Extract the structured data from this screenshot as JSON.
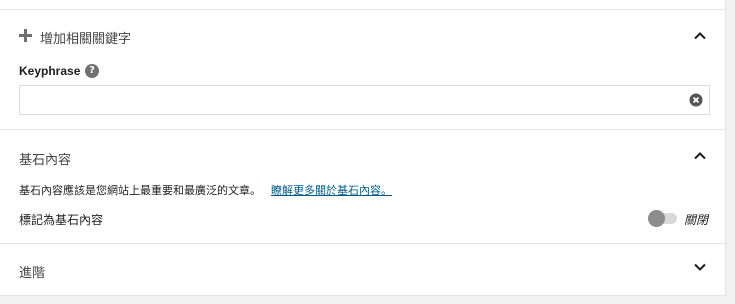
{
  "related_keyphrase": {
    "add_label": "增加相關關鍵字"
  },
  "keyphrase": {
    "label": "Keyphrase",
    "help_icon": "question-circle-icon",
    "value": "",
    "placeholder": ""
  },
  "cornerstone": {
    "title": "基石內容",
    "description": "基石內容應該是您網站上最重要和最廣泛的文章。",
    "learn_more": "瞭解更多關於基石內容。",
    "toggle_label": "標記為基石內容",
    "toggle_state": "關閉"
  },
  "advanced": {
    "title": "進階"
  },
  "colors": {
    "link": "#005a87",
    "toggle_knob": "#8c8c8c",
    "toggle_track": "#d8d8d8"
  }
}
